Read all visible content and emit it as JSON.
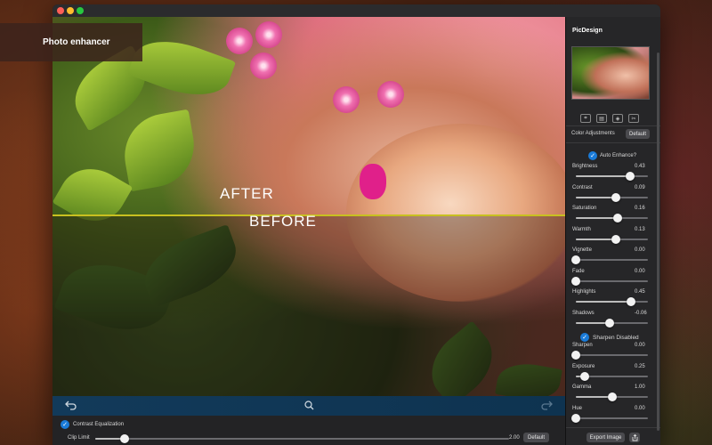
{
  "banner": {
    "title": "Photo enhancer"
  },
  "photo": {
    "after_label": "AFTER",
    "before_label": "BEFORE"
  },
  "toolbar": {
    "back_icon": "undo-icon",
    "zoom_icon": "search-icon",
    "forward_icon": "redo-icon"
  },
  "bottom": {
    "contrast_equalization_label": "Contrast Equalization",
    "contrast_equalization_checked": true,
    "clip_limit_label": "Clip Limit",
    "clip_limit_value": "2.00",
    "clip_limit_fraction": 0.07,
    "default_button": "Default"
  },
  "sidebar": {
    "title": "PicDesign",
    "tools": [
      "crop-icon",
      "layers-icon",
      "filter-icon",
      "scissors-icon"
    ],
    "color_adjustments_label": "Color Adjustments",
    "default_button": "Default",
    "auto_enhance_label": "Auto Enhance?",
    "auto_enhance_checked": true,
    "sliders_a": [
      {
        "label": "Brightness",
        "value": "0.43",
        "fraction": 0.75
      },
      {
        "label": "Contrast",
        "value": "0.09",
        "fraction": 0.55
      },
      {
        "label": "Saturation",
        "value": "0.16",
        "fraction": 0.58
      },
      {
        "label": "Warmth",
        "value": "0.13",
        "fraction": 0.56
      },
      {
        "label": "Vignette",
        "value": "0.00",
        "fraction": 0.0
      },
      {
        "label": "Fade",
        "value": "0.00",
        "fraction": 0.0
      },
      {
        "label": "Highlights",
        "value": "0.45",
        "fraction": 0.76
      },
      {
        "label": "Shadows",
        "value": "-0.06",
        "fraction": 0.47
      }
    ],
    "sharpen_label": "Sharpen Disabled",
    "sharpen_checked": true,
    "sliders_b": [
      {
        "label": "Sharpen",
        "value": "0.00",
        "fraction": 0.0
      },
      {
        "label": "Exposure",
        "value": "0.25",
        "fraction": 0.12
      },
      {
        "label": "Gamma",
        "value": "1.00",
        "fraction": 0.5
      },
      {
        "label": "Hue",
        "value": "0.00",
        "fraction": 0.0
      }
    ],
    "export_button": "Export Image",
    "share_icon": "share-icon"
  }
}
